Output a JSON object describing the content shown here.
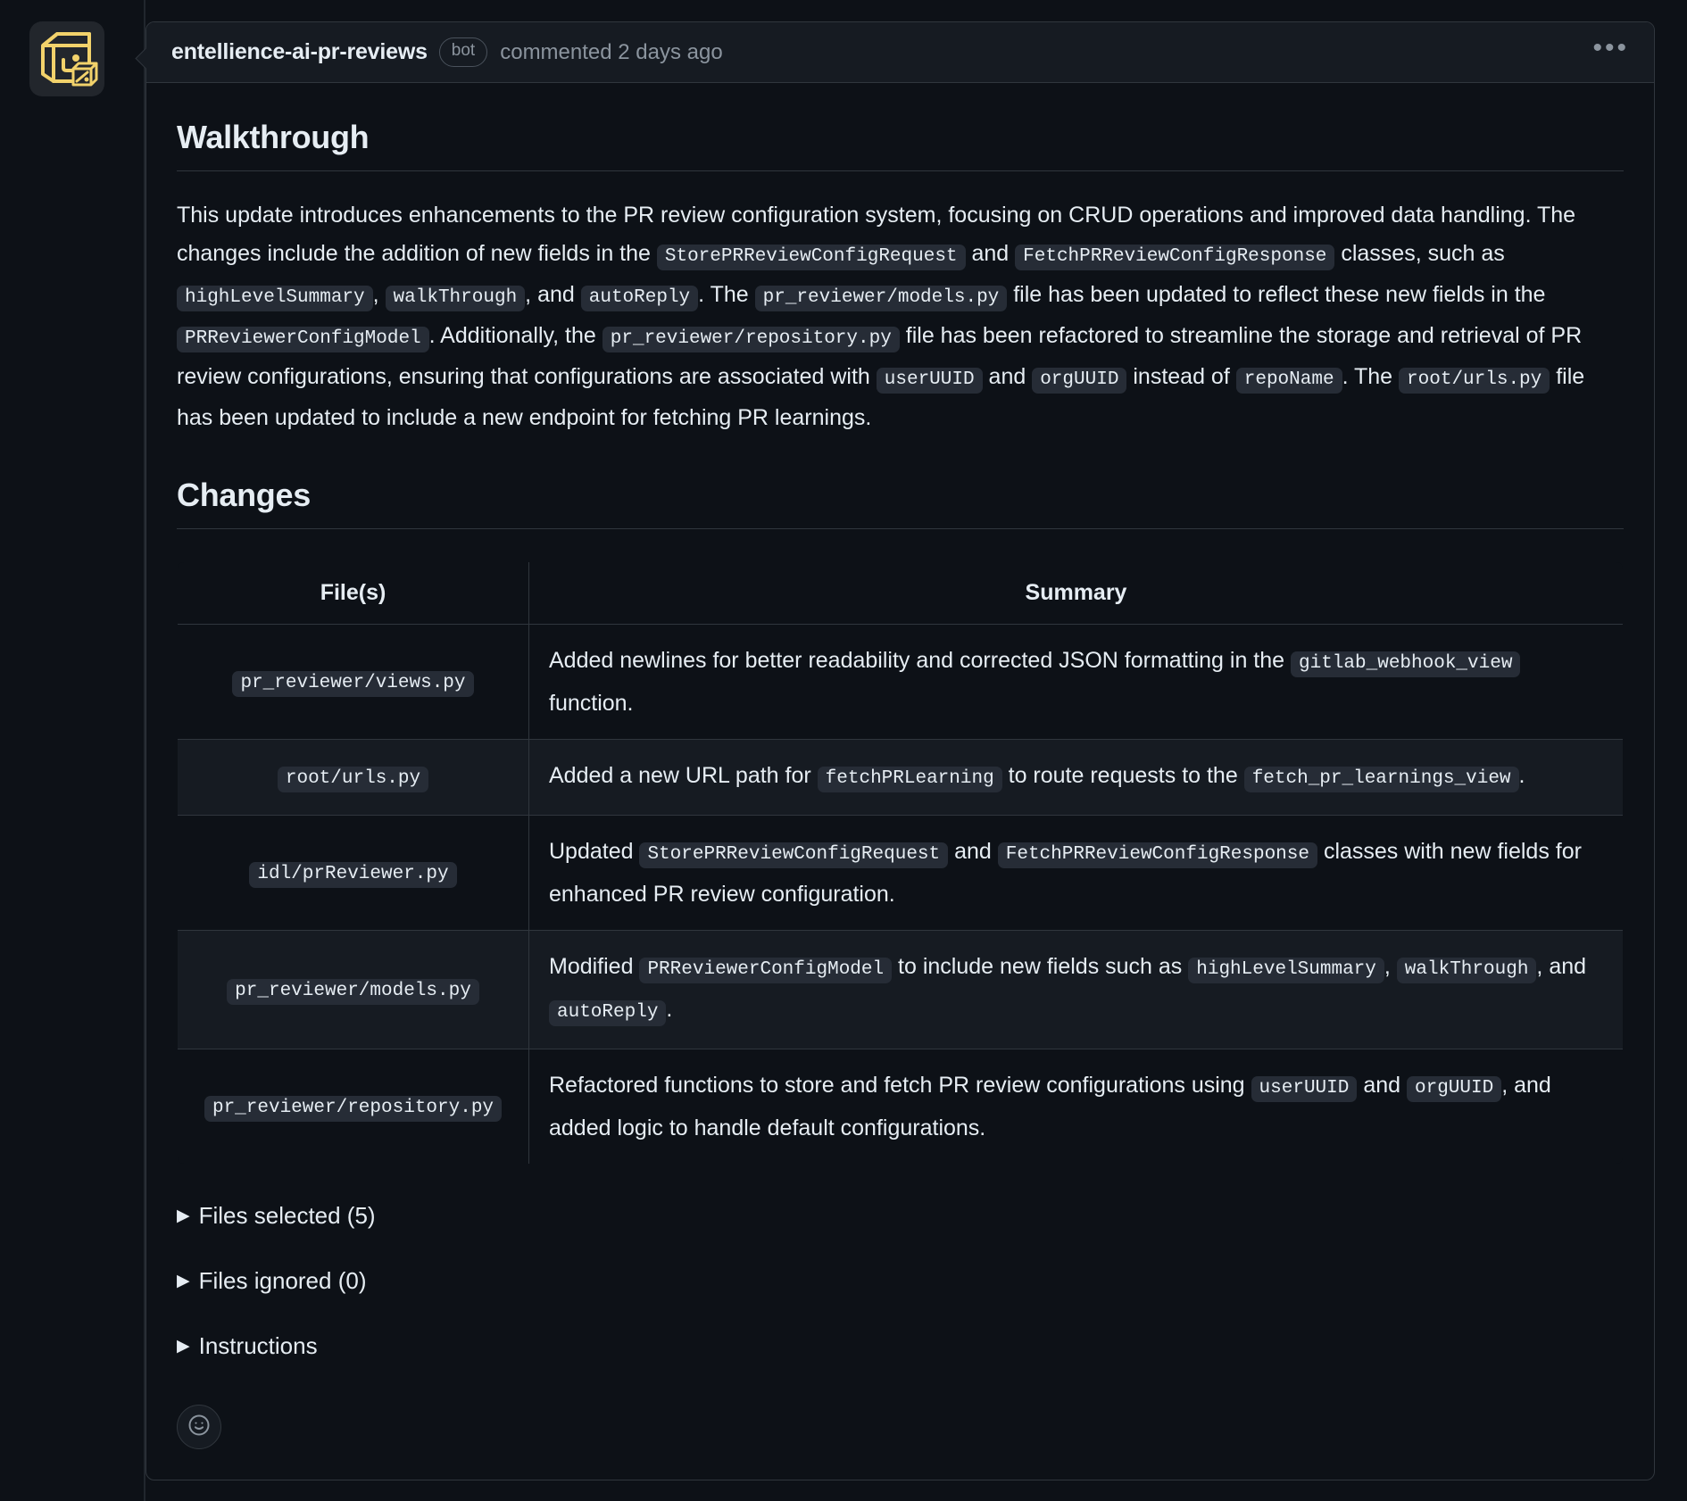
{
  "comment": {
    "author": "entellience-ai-pr-reviews",
    "bot_badge": "bot",
    "meta": "commented 2 days ago",
    "kebab_menu": "•••",
    "avatar_icon": "box-bot-avatar-icon"
  },
  "walkthrough": {
    "heading": "Walkthrough",
    "paragraph": {
      "t1": "This update introduces enhancements to the PR review configuration system, focusing on CRUD operations and improved data handling. The changes include the addition of new fields in the ",
      "c1": "StorePRReviewConfigRequest",
      "t2": " and ",
      "c2": "FetchPRReviewConfigResponse",
      "t3": " classes, such as ",
      "c3": "highLevelSummary",
      "t4": ", ",
      "c4": "walkThrough",
      "t5": ", and ",
      "c5": "autoReply",
      "t6": ". The ",
      "c6": "pr_reviewer/models.py",
      "t7": " file has been updated to reflect these new fields in the ",
      "c7": "PRReviewerConfigModel",
      "t8": ". Additionally, the ",
      "c8": "pr_reviewer/repository.py",
      "t9": " file has been refactored to streamline the storage and retrieval of PR review configurations, ensuring that configurations are associated with ",
      "c9": "userUUID",
      "t10": " and ",
      "c10": "orgUUID",
      "t11": " instead of ",
      "c11": "repoName",
      "t12": ". The ",
      "c12": "root/urls.py",
      "t13": " file has been updated to include a new endpoint for fetching PR learnings."
    }
  },
  "changes": {
    "heading": "Changes",
    "columns": [
      "File(s)",
      "Summary"
    ],
    "rows": [
      {
        "file": "pr_reviewer/views.py",
        "summary": {
          "t1": "Added newlines for better readability and corrected JSON formatting in the ",
          "c1": "gitlab_webhook_view",
          "t2": " function."
        }
      },
      {
        "file": "root/urls.py",
        "summary": {
          "t1": "Added a new URL path for ",
          "c1": "fetchPRLearning",
          "t2": " to route requests to the ",
          "c2": "fetch_pr_learnings_view",
          "t3": "."
        }
      },
      {
        "file": "idl/prReviewer.py",
        "summary": {
          "t1": "Updated ",
          "c1": "StorePRReviewConfigRequest",
          "t2": " and ",
          "c2": "FetchPRReviewConfigResponse",
          "t3": " classes with new fields for enhanced PR review configuration."
        }
      },
      {
        "file": "pr_reviewer/models.py",
        "summary": {
          "t1": "Modified ",
          "c1": "PRReviewerConfigModel",
          "t2": " to include new fields such as ",
          "c2": "highLevelSummary",
          "t3": ", ",
          "c3": "walkThrough",
          "t4": ", and ",
          "c4": "autoReply",
          "t5": "."
        }
      },
      {
        "file": "pr_reviewer/repository.py",
        "summary": {
          "t1": "Refactored functions to store and fetch PR review configurations using ",
          "c1": "userUUID",
          "t2": " and ",
          "c2": "orgUUID",
          "t3": ", and added logic to handle default configurations."
        }
      }
    ]
  },
  "collapsibles": [
    {
      "triangle": "▶",
      "label": "Files selected (5)"
    },
    {
      "triangle": "▶",
      "label": "Files ignored (0)"
    },
    {
      "triangle": "▶",
      "label": "Instructions"
    }
  ],
  "reaction": {
    "icon": "smiley-face-icon"
  },
  "colors": {
    "background": "#0d1117",
    "surface": "#161b22",
    "border": "#30363d",
    "text": "#e6edf3",
    "muted": "#8b949e",
    "code_bg": "#262c36",
    "accent": "#f2d26b"
  }
}
